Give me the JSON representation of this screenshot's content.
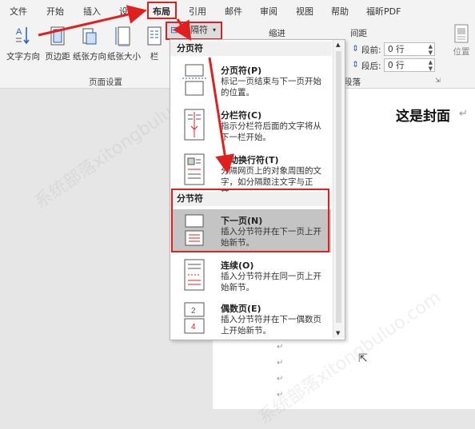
{
  "tabs": [
    "文件",
    "开始",
    "插入",
    "设计",
    "布局",
    "引用",
    "邮件",
    "审阅",
    "视图",
    "帮助",
    "福昕PDF"
  ],
  "ribbon": {
    "text_direction": "文字方向",
    "margins": "页边距",
    "orientation": "纸张方向",
    "size": "纸张大小",
    "columns": "栏",
    "breaks": "分隔符",
    "group_page_setup": "页面设置",
    "indent": "缩进",
    "spacing": "间距",
    "before_label": "段前:",
    "before_value": "0 行",
    "after_label": "段后:",
    "after_value": "0 行",
    "paragraph_group": "段落",
    "position": "位置"
  },
  "document": {
    "cover_text": "这是封面"
  },
  "menu": {
    "page_breaks_header": "分页符",
    "section_breaks_header": "分节符",
    "items": [
      {
        "title": "分页符(P)",
        "desc": "标记一页结束与下一页开始的位置。"
      },
      {
        "title": "分栏符(C)",
        "desc": "指示分栏符后面的文字将从下一栏开始。"
      },
      {
        "title": "自动换行符(T)",
        "desc": "分隔网页上的对象周围的文字，如分隔题注文字与正文。"
      },
      {
        "title": "下一页(N)",
        "desc": "插入分节符并在下一页上开始新节。"
      },
      {
        "title": "连续(O)",
        "desc": "插入分节符并在同一页上开始新节。"
      },
      {
        "title": "偶数页(E)",
        "desc": "插入分节符并在下一偶数页上开始新节。"
      }
    ]
  },
  "colors": {
    "highlight_red": "#e0201f",
    "hover_gray": "#c4c4c4"
  }
}
